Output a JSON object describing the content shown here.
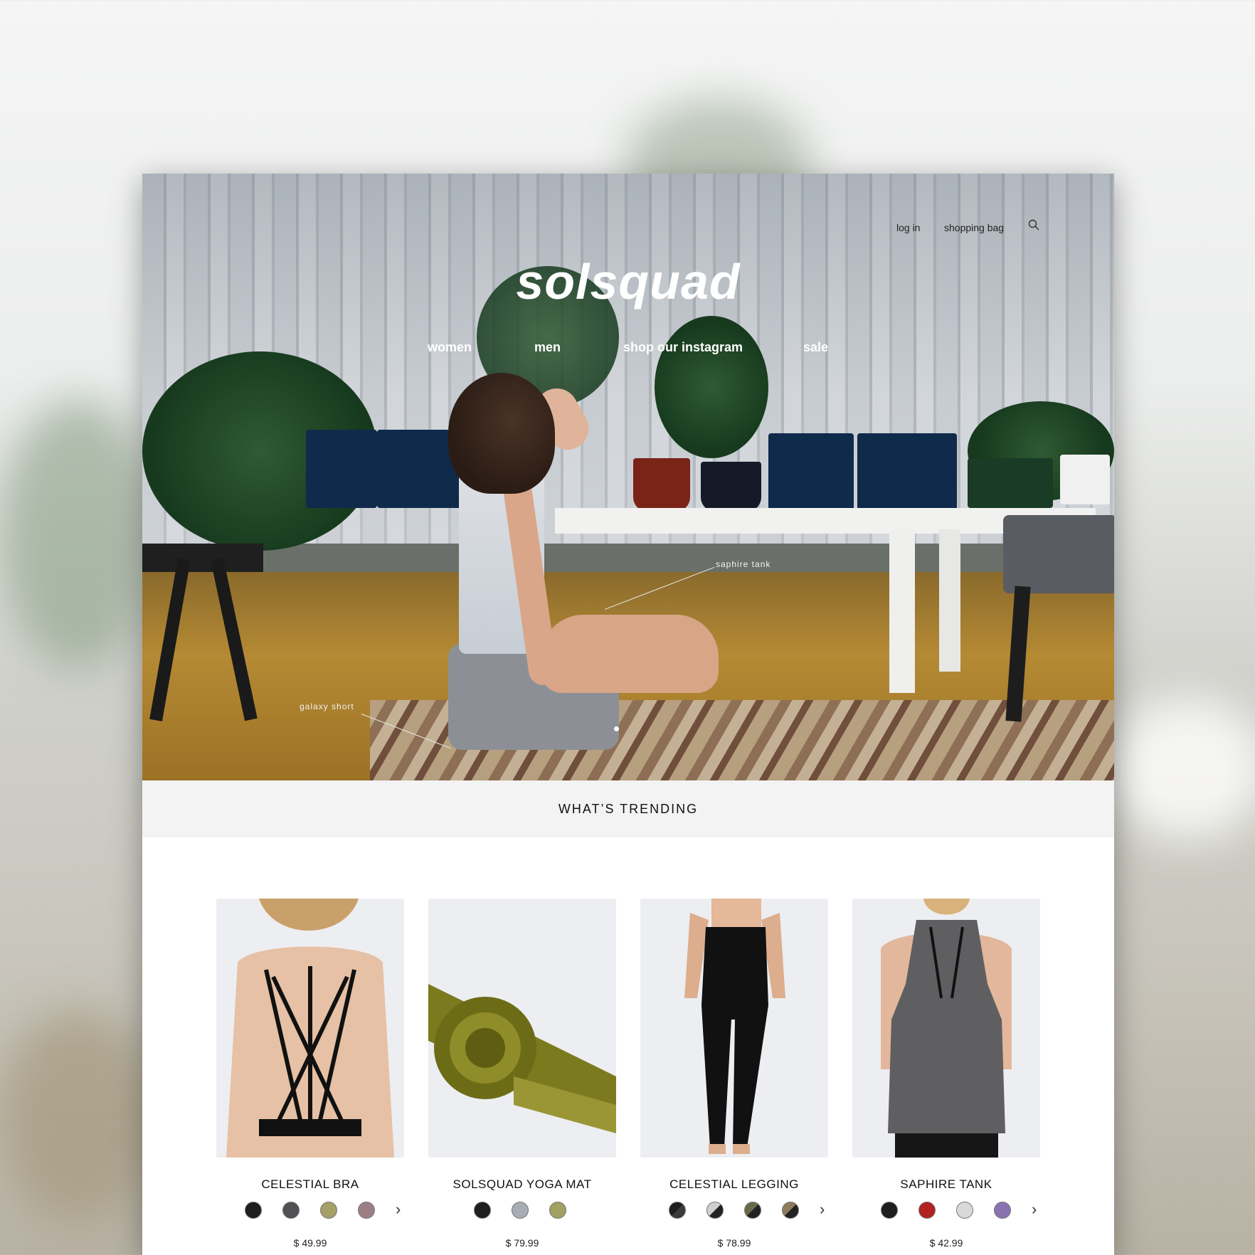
{
  "header": {
    "login_label": "log in",
    "bag_label": "shopping bag",
    "search_icon": "search-icon",
    "logo": "solsquad"
  },
  "nav": {
    "items": [
      {
        "label": "women"
      },
      {
        "label": "men"
      },
      {
        "label": "shop our instagram"
      },
      {
        "label": "sale"
      }
    ]
  },
  "hero": {
    "tags": [
      {
        "label": "saphire tank"
      },
      {
        "label": "galaxy short"
      }
    ]
  },
  "trending": {
    "title": "WHAT’S TRENDING",
    "products": [
      {
        "name": "CELESTIAL BRA",
        "price": "$ 49.99",
        "swatches": [
          "#1e1e1e",
          "#4f5154",
          "#a4a068",
          "#9c7f84"
        ],
        "more": true
      },
      {
        "name": "SOLSQUAD YOGA MAT",
        "price": "$ 79.99",
        "swatches": [
          "#1e1e1e",
          "#a8acb4",
          "#a19f61"
        ],
        "more": false
      },
      {
        "name": "CELESTIAL LEGGING",
        "price": "$ 78.99",
        "swatches": [
          "#1e1e1e",
          "#8e8e8e",
          "#6b6a48",
          "#8d7b5c"
        ],
        "more": true
      },
      {
        "name": "SAPHIRE TANK",
        "price": "$ 42.99",
        "swatches": [
          "#1e1e1e",
          "#b22222",
          "#d9d9d9",
          "#8a72b0"
        ],
        "more": true
      }
    ]
  },
  "colors": {
    "accent": "#ffffff",
    "trending_bg": "#f3f3f3"
  }
}
